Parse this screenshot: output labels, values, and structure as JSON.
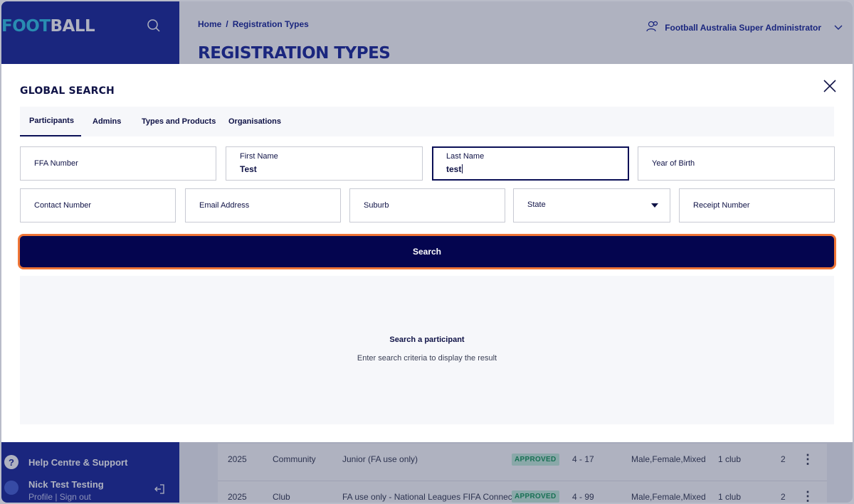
{
  "brand": {
    "logo_accent": "FOOT",
    "logo_rest": "BALL"
  },
  "topbar": {
    "breadcrumb": [
      "Home",
      "Registration Types"
    ],
    "breadcrumb_sep": "/",
    "page_title": "REGISTRATION TYPES",
    "user": "Football Australia Super Administrator"
  },
  "sidebar": {
    "help_icon": "?",
    "help_label": "Help Centre & Support",
    "profile_name": "Nick Test Testing",
    "profile_links": "Profile | Sign out"
  },
  "table": {
    "rows": [
      {
        "year": "2025",
        "type": "Community",
        "name": "Junior (FA use only)",
        "status": "APPROVED",
        "age": "4 - 17",
        "gender": "Male,Female,Mixed",
        "scope": "1 club",
        "extra": "2",
        "menu": "⋮"
      },
      {
        "year": "2025",
        "type": "Club",
        "name": "FA use only - National Leagues FIFA Connect",
        "status": "APPROVED",
        "age": "4 - 99",
        "gender": "Male,Female,Mixed",
        "scope": "1 club",
        "extra": "2",
        "menu": "⋮"
      }
    ]
  },
  "modal": {
    "title": "GLOBAL SEARCH",
    "tabs": [
      "Participants",
      "Admins",
      "Types and Products",
      "Organisations"
    ],
    "active_tab": "Participants",
    "fields": {
      "ffa_number": {
        "label": "FFA Number",
        "value": ""
      },
      "first_name": {
        "label": "First Name",
        "value": "Test"
      },
      "last_name": {
        "label": "Last Name",
        "value": "test"
      },
      "year_of_birth": {
        "label": "Year of Birth",
        "value": ""
      },
      "contact_number": {
        "label": "Contact Number",
        "value": ""
      },
      "email_address": {
        "label": "Email Address",
        "value": ""
      },
      "suburb": {
        "label": "Suburb",
        "value": ""
      },
      "state": {
        "label": "State",
        "value": ""
      },
      "receipt_number": {
        "label": "Receipt Number",
        "value": ""
      }
    },
    "search_button": "Search",
    "empty_state": {
      "title": "Search a participant",
      "subtitle": "Enter search criteria to display the result"
    }
  },
  "colors": {
    "primary_navy": "#04054f",
    "brand_blue": "#1e2b9b",
    "focus_outline": "#ef7536",
    "approved_badge": "#c7f0dc"
  },
  "icons": [
    "search-icon",
    "user-icon",
    "chevron-down-icon",
    "close-icon",
    "help-icon",
    "sign-out-icon",
    "kebab-menu-icon",
    "dropdown-caret-icon"
  ]
}
